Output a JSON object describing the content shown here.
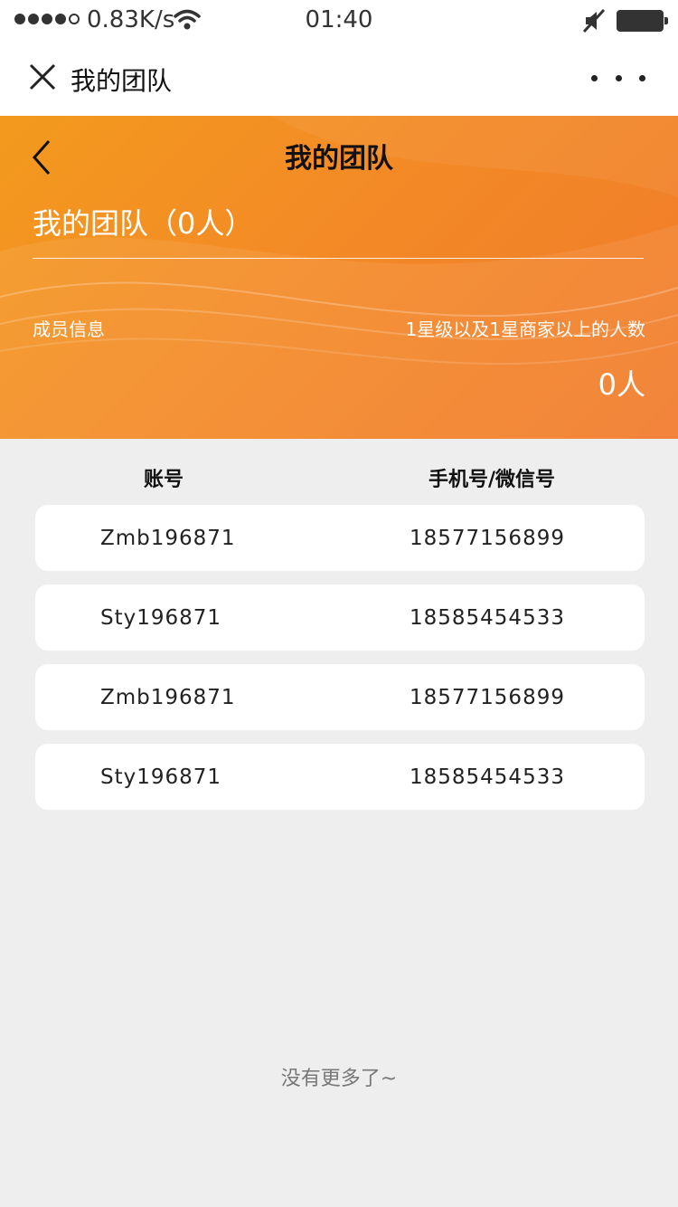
{
  "status_bar": {
    "net_speed": "0.83K/s",
    "time": "01:40"
  },
  "nav": {
    "title": "我的团队"
  },
  "header": {
    "title": "我的团队",
    "team_count": "我的团队（0人）",
    "member_info_label": "成员信息",
    "star_label": "1星级以及1星商家以上的人数",
    "star_count": "0人"
  },
  "table": {
    "columns": [
      "账号",
      "手机号/微信号"
    ],
    "rows": [
      {
        "account": "Zmb196871",
        "phone": "18577156899"
      },
      {
        "account": "Sty196871",
        "phone": "18585454533"
      },
      {
        "account": "Zmb196871",
        "phone": "18577156899"
      },
      {
        "account": "Sty196871",
        "phone": "18585454533"
      }
    ]
  },
  "footer": {
    "no_more": "没有更多了~"
  },
  "colors": {
    "accent_start": "#f39a1e",
    "accent_end": "#f17a2b",
    "background": "#eeeeee"
  }
}
